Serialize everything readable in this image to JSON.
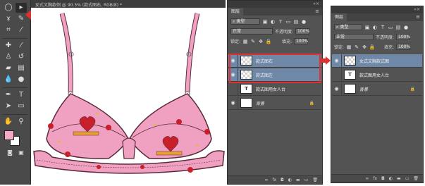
{
  "document": {
    "tab_title": "女式文胸款例 @ 90.5% (款式图右, RGB/8) *"
  },
  "panel_left": {
    "tab_label": "图层",
    "kind_label": "类型",
    "blend_mode": "正常",
    "opacity_label": "不透明度:",
    "opacity_value": "100%",
    "lock_label": "锁定:",
    "fill_label": "填充:",
    "fill_value": "100%",
    "layers": [
      {
        "name": "款式图右",
        "selected": true
      },
      {
        "name": "款式图左",
        "selected": true
      },
      {
        "name": "款式图用女人台",
        "selected": false
      },
      {
        "name": "背景",
        "selected": false
      }
    ]
  },
  "panel_right": {
    "tab_label": "图层",
    "kind_label": "类型",
    "blend_mode": "正常",
    "opacity_label": "不透明度:",
    "opacity_value": "100%",
    "lock_label": "锁定:",
    "fill_label": "填充:",
    "fill_value": "100%",
    "layers": [
      {
        "name": "女式文胸款式图",
        "selected": true
      },
      {
        "name": "款式图用女人台",
        "selected": false
      },
      {
        "name": "背景",
        "selected": false
      }
    ]
  },
  "footer_icons": [
    "link-icon",
    "fx-icon",
    "mask-icon",
    "adjustment-icon",
    "group-icon",
    "new-layer-icon",
    "trash-icon"
  ],
  "colors": {
    "highlight_red": "#e03030",
    "bra_pink": "#f0a0c0",
    "bra_outline": "#5a2a3a",
    "selected_layer": "#6f88a8",
    "foreground_swatch": "#f2a9c4"
  }
}
